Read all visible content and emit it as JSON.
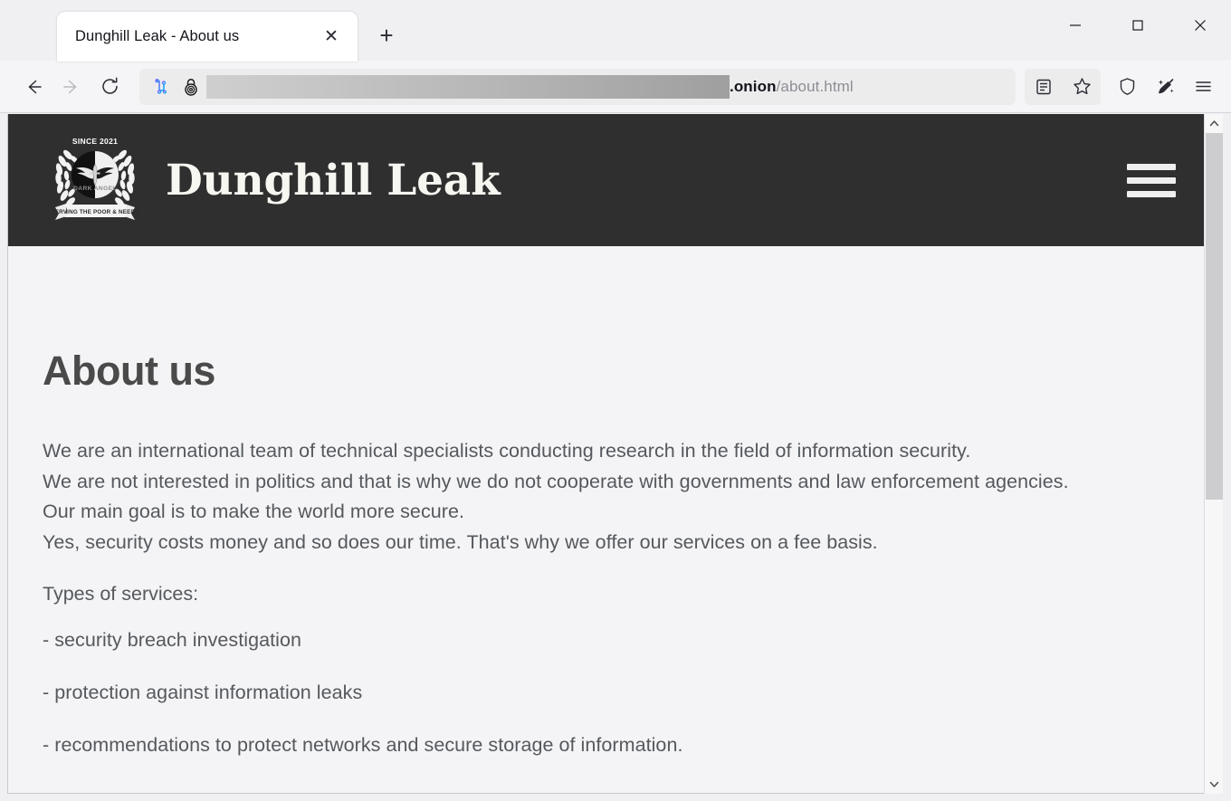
{
  "browser": {
    "tab": {
      "title": "Dunghill Leak - About us",
      "close_label": "✕"
    },
    "newtab_label": "+",
    "window_controls": {
      "minimize": "minimize-button",
      "maximize": "maximize-button",
      "close": "close-button"
    },
    "nav": {
      "back": "back-button",
      "forward": "forward-button",
      "reload": "reload-button"
    },
    "url": {
      "redacted": true,
      "domain_suffix": ".onion",
      "path": "/about.html",
      "full_visible": ".onion/about.html"
    },
    "toolbar_icons": [
      "reader-view-icon",
      "bookmark-star-icon",
      "shield-icon",
      "cleaner-broom-icon",
      "hamburger-menu-icon"
    ]
  },
  "site": {
    "logo": {
      "since": "SINCE 2021",
      "brand": "DARK ANGEL",
      "motto": "SERVING THE POOR & NEEDY"
    },
    "title": "Dunghill Leak",
    "menu_label": "menu",
    "colors": {
      "header_bg": "#2f2f2f",
      "page_bg": "#f4f4f6",
      "text": "#55585d",
      "heading": "#4a4a4a"
    }
  },
  "page": {
    "heading": "About us",
    "paragraph_lines": [
      "We are an international team of technical specialists conducting research in the field of information security.",
      "We are not interested in politics and that is why we do not cooperate with governments and law enforcement agencies.",
      "Our main goal is to make the world more secure.",
      "Yes, security costs money and so does our time. That's why we offer our services on a fee basis."
    ],
    "services_label": "Types of services:",
    "services": [
      "- security breach investigation",
      "- protection against information leaks",
      "- recommendations to protect networks and secure storage of information."
    ]
  },
  "scrollbar": {
    "up_arrow": "⌃",
    "down_arrow": "⌄"
  }
}
